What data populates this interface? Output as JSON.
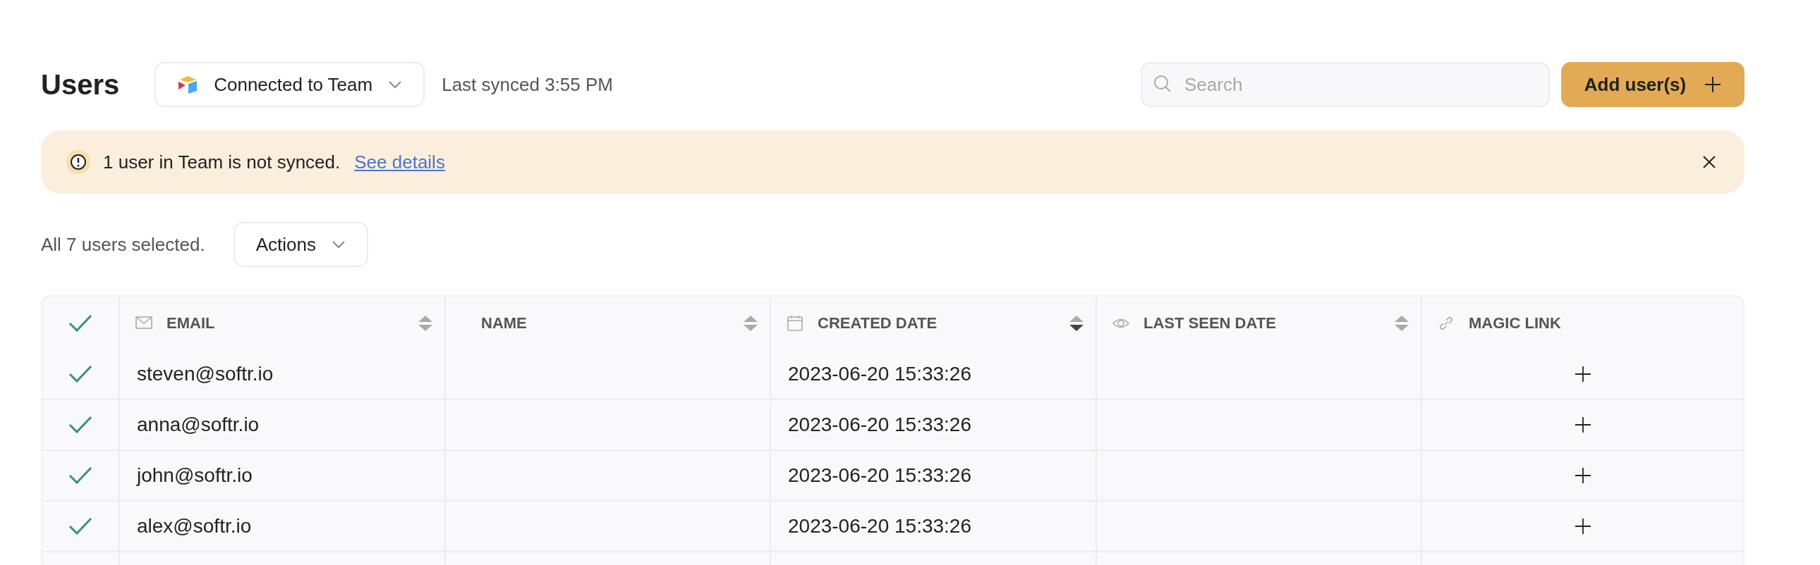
{
  "header": {
    "title": "Users",
    "connection": "Connected to Team",
    "last_synced": "Last synced 3:55 PM",
    "search": {
      "placeholder": "Search"
    },
    "add_button": "Add user(s)"
  },
  "alert": {
    "message": "1 user in Team is not synced.",
    "link": "See details"
  },
  "selection": {
    "text": "All 7 users selected.",
    "actions": "Actions"
  },
  "table": {
    "all_checked": true,
    "columns": [
      {
        "label": "EMAIL",
        "kind": "email",
        "sorted": false
      },
      {
        "label": "NAME",
        "kind": "text",
        "sorted": false
      },
      {
        "label": "CREATED DATE",
        "kind": "date",
        "sorted": true
      },
      {
        "label": "LAST SEEN DATE",
        "kind": "seen",
        "sorted": false
      },
      {
        "label": "MAGIC LINK",
        "kind": "link"
      }
    ],
    "rows": [
      {
        "checked": true,
        "email": "steven@softr.io",
        "created": "2023-06-20 15:33:26"
      },
      {
        "checked": true,
        "email": "anna@softr.io",
        "created": "2023-06-20 15:33:26"
      },
      {
        "checked": true,
        "email": "john@softr.io",
        "created": "2023-06-20 15:33:26"
      },
      {
        "checked": true,
        "email": "alex@softr.io",
        "created": "2023-06-20 15:33:26"
      }
    ]
  }
}
